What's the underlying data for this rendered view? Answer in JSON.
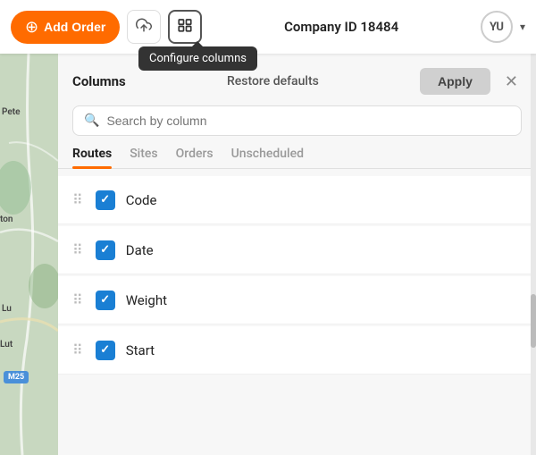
{
  "header": {
    "add_order_label": "Add Order",
    "company_label": "Company ID 18484",
    "avatar_initials": "YU"
  },
  "tooltip": {
    "text": "Configure columns"
  },
  "panel": {
    "title": "Columns",
    "restore_defaults_label": "Restore defaults",
    "apply_label": "Apply",
    "search_placeholder": "Search by column"
  },
  "tabs": [
    {
      "label": "Routes",
      "active": true
    },
    {
      "label": "Sites",
      "active": false
    },
    {
      "label": "Orders",
      "active": false
    },
    {
      "label": "Unscheduled",
      "active": false
    }
  ],
  "columns": [
    {
      "name": "Code",
      "checked": true
    },
    {
      "name": "Date",
      "checked": true
    },
    {
      "name": "Weight",
      "checked": true
    },
    {
      "name": "Start",
      "checked": true
    }
  ],
  "map": {
    "label1": "Pete",
    "label2": "ton",
    "label3": "Lu",
    "label4": "Lut",
    "badge": "M25"
  }
}
